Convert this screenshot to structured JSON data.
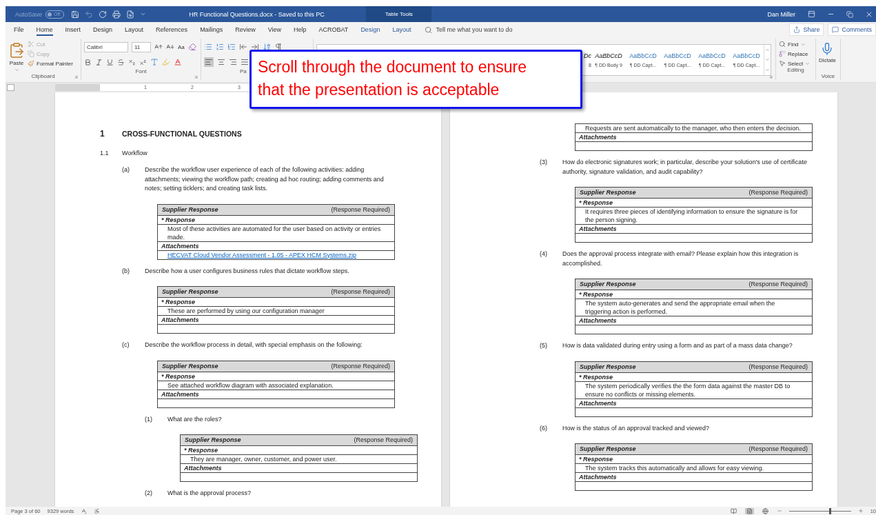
{
  "title_bar": {
    "autosave": {
      "label": "AutoSave",
      "state": "Off",
      "on": false
    },
    "title": "HR Functional Questions.docx  -  Saved to this PC",
    "context_tab": "Table Tools",
    "user": "Dan Miller"
  },
  "menu_tabs": [
    {
      "label": "File",
      "selected": false,
      "contextual": false
    },
    {
      "label": "Home",
      "selected": true,
      "contextual": false
    },
    {
      "label": "Insert",
      "selected": false,
      "contextual": false
    },
    {
      "label": "Design",
      "selected": false,
      "contextual": false
    },
    {
      "label": "Layout",
      "selected": false,
      "contextual": false
    },
    {
      "label": "References",
      "selected": false,
      "contextual": false
    },
    {
      "label": "Mailings",
      "selected": false,
      "contextual": false
    },
    {
      "label": "Review",
      "selected": false,
      "contextual": false
    },
    {
      "label": "View",
      "selected": false,
      "contextual": false
    },
    {
      "label": "Help",
      "selected": false,
      "contextual": false
    },
    {
      "label": "ACROBAT",
      "selected": false,
      "contextual": false
    },
    {
      "label": "Design",
      "selected": false,
      "contextual": true
    },
    {
      "label": "Layout",
      "selected": false,
      "contextual": true
    }
  ],
  "tell_me": {
    "placeholder": "Tell me what you want to do"
  },
  "share": "Share",
  "comments": "Comments",
  "ribbon": {
    "clipboard": {
      "paste": "Paste",
      "cut": {
        "label": "Cut",
        "disabled": true
      },
      "copy": {
        "label": "Copy",
        "disabled": true
      },
      "format_painter": "Format Painter",
      "group_label": "Clipboard"
    },
    "font": {
      "name": "Calibri",
      "size": "11",
      "change_case": "Aa",
      "group_label": "Font"
    },
    "paragraph": {
      "group_label": "Pa"
    },
    "styles": [
      {
        "preview": "Dc",
        "name": "8",
        "kind": "body"
      },
      {
        "preview": "AaBbCcD",
        "name": "¶ DD Body 9",
        "kind": "body"
      },
      {
        "preview": "AaBbCcD",
        "name": "¶ DD Capt...",
        "kind": "caption"
      },
      {
        "preview": "AaBbCcD",
        "name": "¶ DD Capt...",
        "kind": "caption"
      },
      {
        "preview": "AaBbCcD",
        "name": "¶ DD Capt...",
        "kind": "caption"
      },
      {
        "preview": "AaBbCcD",
        "name": "¶ DD Capt...",
        "kind": "caption"
      }
    ],
    "editing": {
      "find": "Find",
      "replace": "Replace",
      "select": "Select",
      "group_label": "Editing"
    },
    "voice": {
      "dictate": "Dictate",
      "group_label": "Voice"
    }
  },
  "ruler": {
    "labels": [
      "1",
      "2",
      "3"
    ]
  },
  "callout": "Scroll through the document to ensure that the presentation is acceptable",
  "pages": [
    {
      "blocks": [
        {
          "kind": "heading",
          "number": "1",
          "title": "CROSS-FUNCTIONAL QUESTIONS"
        },
        {
          "kind": "subheading",
          "number": "1.1",
          "title": "Workflow",
          "children": [
            {
              "kind": "item",
              "number": "(a)",
              "title": "Describe the workflow user experience of each of the following activities: adding attachments; viewing the workflow path; creating ad hoc routing; adding comments and notes; setting ticklers; and creating task lists.",
              "table": {
                "header": "Supplier Response",
                "required": "(Response Required)",
                "response_label": "* Response",
                "response": "Most of these activities are automated for the user based on activity or entries made.",
                "attachments_label": "Attachments",
                "attachment": {
                  "text": "HECVAT Cloud Vendor Assessment - 1.05 - APEX HCM Systems.zip",
                  "kind": "link"
                }
              }
            },
            {
              "kind": "item",
              "number": "(b)",
              "title": "Describe how a user configures business rules that dictate workflow steps.",
              "table": {
                "header": "Supplier Response",
                "required": "(Response Required)",
                "response_label": "* Response",
                "response": "These are performed by using our configuration manager",
                "attachments_label": "Attachments"
              }
            },
            {
              "kind": "item",
              "number": "(c)",
              "title": "Describe the workflow process in detail, with special emphasis on the following:",
              "table": {
                "header": "Supplier Response",
                "required": "(Response Required)",
                "response_label": "* Response",
                "response": "See attached workflow diagram with associated explanation.",
                "attachments_label": "Attachments"
              },
              "children": [
                {
                  "kind": "item",
                  "number": "(1)",
                  "title": "What are the roles?",
                  "table": {
                    "header": "Supplier Response",
                    "required": "(Response Required)",
                    "response_label": "* Response",
                    "response": "They are manager, owner, customer, and power user.",
                    "attachments_label": "Attachments"
                  }
                },
                {
                  "kind": "item",
                  "number": "(2)",
                  "title": "What is the approval process?"
                }
              ]
            }
          ]
        }
      ]
    },
    {
      "blocks": [
        {
          "kind": "subheading",
          "children": [
            {
              "kind": "item",
              "children": [
                {
                  "kind": "item",
                  "table": {
                    "response": "Requests are sent automatically to the manager, who then enters the decision.",
                    "attachments_label": "Attachments"
                  }
                },
                {
                  "kind": "item",
                  "number": "(3)",
                  "title": "How do electronic signatures work; in particular, describe your solution's use of certificate authority, signature validation, and audit capability?",
                  "table": {
                    "header": "Supplier Response",
                    "required": "(Response Required)",
                    "response_label": "* Response",
                    "response": "It requires three pieces of identifying information to ensure the signature is for the person signing.",
                    "attachments_label": "Attachments"
                  }
                },
                {
                  "kind": "item",
                  "number": "(4)",
                  "title": "Does the approval process integrate with email? Please explain how this integration is accomplished.",
                  "table": {
                    "header": "Supplier Response",
                    "required": "(Response Required)",
                    "response_label": "* Response",
                    "response": "The system auto-generates and send the appropriate email when the triggering action is performed.",
                    "attachments_label": "Attachments"
                  }
                },
                {
                  "kind": "item",
                  "number": "(5)",
                  "title": "How is data validated during entry using a form and as part of a mass data change?",
                  "table": {
                    "header": "Supplier Response",
                    "required": "(Response Required)",
                    "response_label": "* Response",
                    "response": "The system periodically verifies the the form data against the master DB to ensure no conflicts or missing elements.",
                    "attachments_label": "Attachments"
                  }
                },
                {
                  "kind": "item",
                  "number": "(6)",
                  "title": "How is the status of an approval tracked and viewed?",
                  "table": {
                    "header": "Supplier Response",
                    "required": "(Response Required)",
                    "response_label": "* Response",
                    "response": "The system tracks this automatically and allows for easy viewing.",
                    "attachments_label": "Attachments"
                  }
                }
              ]
            }
          ]
        }
      ]
    }
  ],
  "status_bar": {
    "page": "Page 3 of 60",
    "words": "9329 words",
    "views": [
      {
        "kind": "read",
        "selected": false
      },
      {
        "kind": "print",
        "selected": true
      },
      {
        "kind": "web",
        "selected": false
      }
    ],
    "zoom": {
      "level": 0.65,
      "label": "10"
    }
  }
}
